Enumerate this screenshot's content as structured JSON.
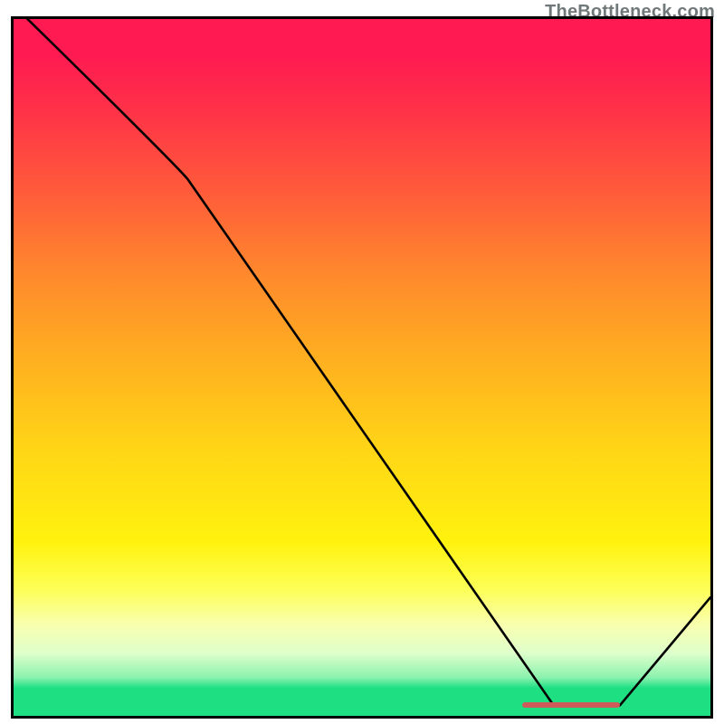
{
  "watermark": "TheBottleneck.com",
  "chart_data": {
    "type": "line",
    "title": "",
    "xlabel": "",
    "ylabel": "",
    "x_range": [
      0,
      100
    ],
    "y_range": [
      0,
      100
    ],
    "series": [
      {
        "name": "bottleneck-curve",
        "x": [
          2,
          25,
          77.5,
          87,
          100
        ],
        "y": [
          100,
          77,
          1.5,
          1.5,
          17
        ]
      }
    ],
    "optimal_band": {
      "x_start": 73,
      "x_end": 87,
      "y": 1.5
    },
    "background_gradient": {
      "top_color": "#ff1a52",
      "mid_color": "#fff20e",
      "bottom_color": "#1fdf83"
    }
  }
}
